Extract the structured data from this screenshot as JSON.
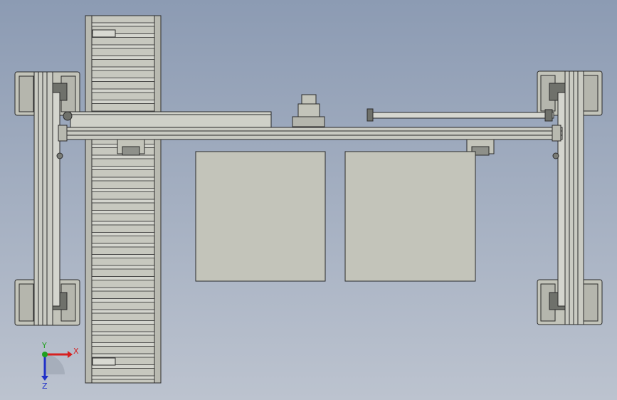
{
  "scene": {
    "background_top": "#8c9bb3",
    "background_bottom": "#bcc3cf",
    "part_fill": "#c3c4ba",
    "line_color": "#2b2b2b"
  },
  "triad": {
    "x_label": "X",
    "y_label": "Y",
    "z_label": "Z",
    "x_color": "#d62020",
    "y_color": "#1fa01f",
    "z_color": "#2030c8"
  }
}
